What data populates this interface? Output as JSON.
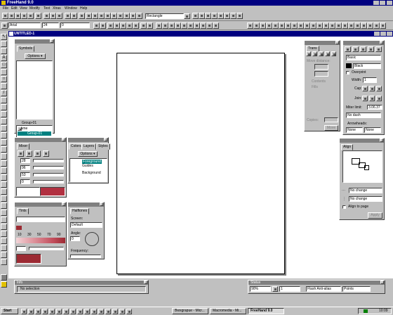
{
  "window": {
    "title": "FreeHand 9.0"
  },
  "menu": [
    "File",
    "Edit",
    "View",
    "Modify",
    "Text",
    "Xtras",
    "Window",
    "Help"
  ],
  "toolbar": {
    "shape_select": "Rectangle",
    "font_name": "Arial",
    "font_size": "24",
    "leading": "0"
  },
  "document": {
    "tab_title": "UNTITLED-1"
  },
  "symbols_panel": {
    "tab": "Symbols",
    "options_label": "Options",
    "group_label": "Group-01",
    "list_header": "Name",
    "list_item": "Group-01"
  },
  "mixer_panel": {
    "tab": "Mixer",
    "values": [
      "28",
      "96",
      "53",
      "0"
    ],
    "swatch_color_a": "#ffffff",
    "swatch_color_b": "#b13040"
  },
  "layers_panel": {
    "tabs": [
      "Colors",
      "Layers",
      "Styles"
    ],
    "options_label": "Options",
    "layers": [
      "Foreground",
      "Guides",
      "Background"
    ]
  },
  "tints_panel": {
    "tab": "Tints",
    "percent_labels": [
      "10",
      "30",
      "50",
      "70",
      "90"
    ],
    "base_color": "#9c2a33"
  },
  "halftones_panel": {
    "tab": "Halftones",
    "screen_label": "Screen:",
    "screen_value": "Default",
    "angle_label": "Angle:",
    "angle_value": "0",
    "frequency_label": "Frequency:"
  },
  "transform_panel": {
    "tab": "Trans",
    "move_label": "Move distance:",
    "contents_label": "Contents",
    "fills_label": "Fills",
    "copies_label": "Copies:",
    "apply_label": "Move"
  },
  "stroke_panel": {
    "type_value": "Basic",
    "color_value": "Black",
    "overprint_label": "Overprint",
    "width_label": "Width:",
    "width_value": "1",
    "cap_label": "Cap:",
    "join_label": "Join:",
    "miter_label": "Miter limit:",
    "miter_value": "3.06.37",
    "dash_value": "No dash",
    "arrowheads_label": "Arrowheads:",
    "arrow_left": "None",
    "arrow_right": "None"
  },
  "align_panel": {
    "tab": "Align",
    "horizontal_value": "No change",
    "vertical_value": "No change",
    "align_to_page_label": "Align to page",
    "apply_label": "Apply"
  },
  "info_panel": {
    "tab": "Info",
    "message": "No selection"
  },
  "status_panel": {
    "tab": "Status",
    "zoom": "90%",
    "page": "1",
    "preview_mode": "Flash Anti-alias",
    "units": "Points"
  },
  "taskbar": {
    "start_label": "Start",
    "tasks": [
      "Bwxgrapue - Micr...",
      "Macromedia - Mi...",
      "FreeHand 9.0"
    ],
    "clock": "10:09"
  },
  "colors": {
    "title_active": "#000080",
    "face": "#c0c0c0",
    "red_swatch": "#b13040"
  }
}
